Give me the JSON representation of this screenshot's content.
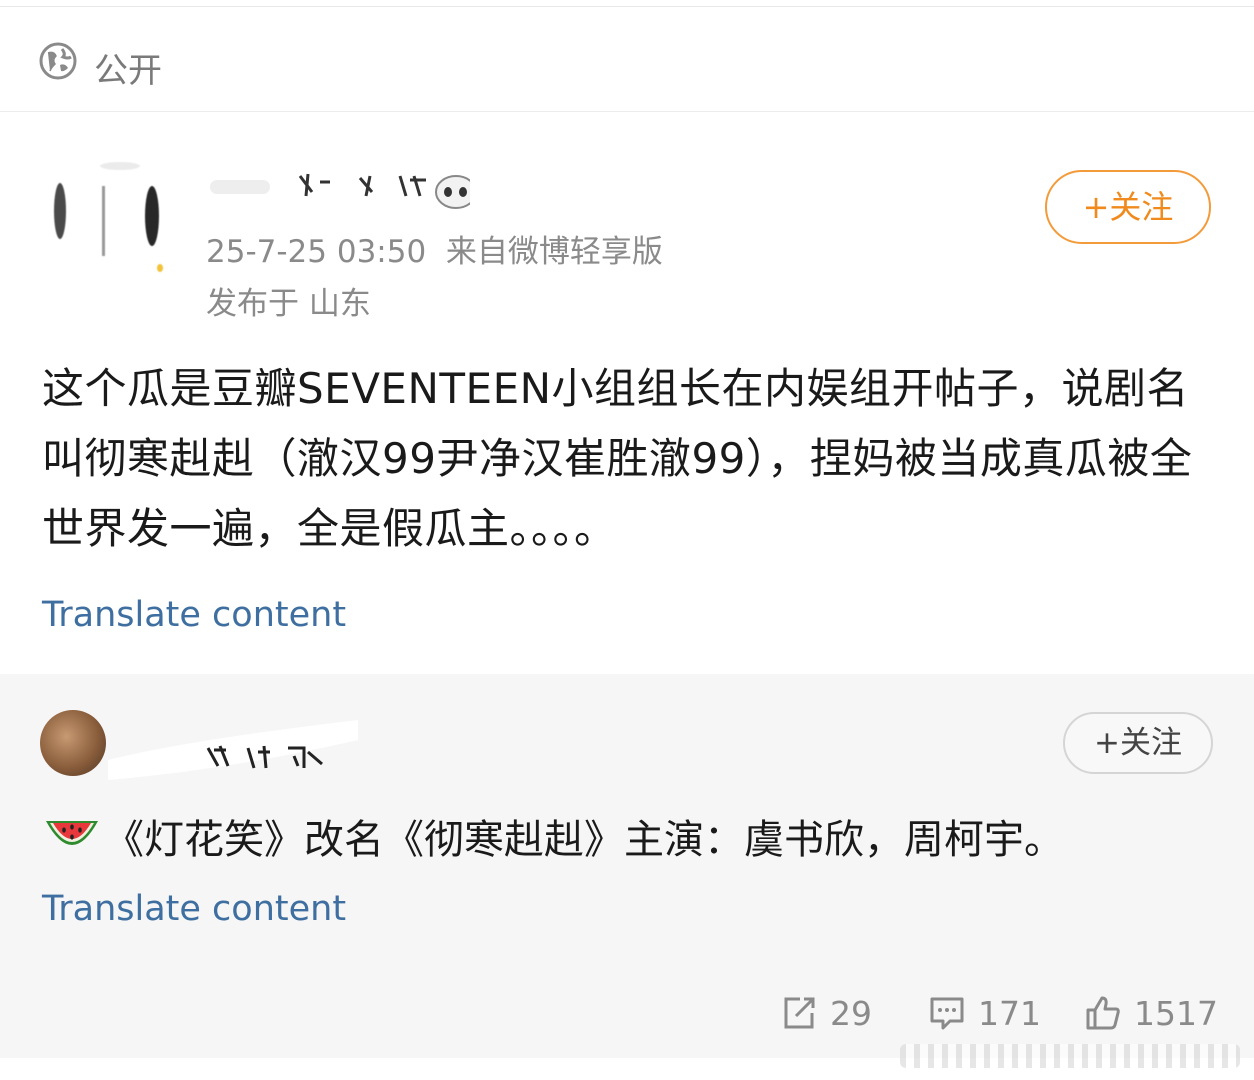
{
  "visibility": {
    "icon": "globe-icon",
    "label": "公开"
  },
  "post": {
    "timestamp": "25-7-25 03:50",
    "source": "来自微博轻享版",
    "location": "发布于 山东",
    "follow_label": "+关注",
    "text": "这个瓜是豆瓣SEVENTEEN小组组长在内娱组开帖子，说剧名叫彻寒赳赳（澈汉99尹净汉崔胜澈99），捏妈被当成真瓜被全世界发一遍，全是假瓜主。。。。",
    "translate_label": "Translate content"
  },
  "repost": {
    "follow_label": "+关注",
    "emoji": "watermelon-icon",
    "text": "《灯花笑》改名《彻寒赳赳》主演：虞书欣，周柯宇。",
    "translate_label": "Translate content"
  },
  "actions": {
    "share_count": "29",
    "comment_count": "171",
    "like_count": "1517"
  },
  "colors": {
    "accent_orange": "#f08a1c",
    "link_blue": "#3e6fa0",
    "meta_gray": "#8a8a8a"
  }
}
